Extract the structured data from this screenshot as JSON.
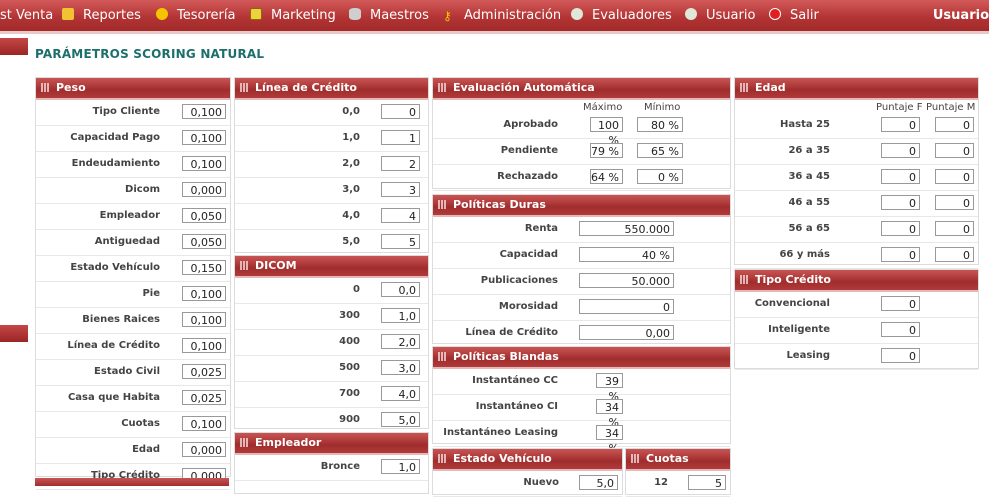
{
  "menu": {
    "items": [
      {
        "label": "st Venta",
        "icon": "none"
      },
      {
        "label": "Reportes",
        "icon": "report-icon"
      },
      {
        "label": "Tesorería",
        "icon": "coin-icon"
      },
      {
        "label": "Marketing",
        "icon": "monitor-icon"
      },
      {
        "label": "Maestros",
        "icon": "database-icon"
      },
      {
        "label": "Administración",
        "icon": "key-icon"
      },
      {
        "label": "Evaluadores",
        "icon": "gears-icon"
      },
      {
        "label": "Usuario",
        "icon": "gears-icon"
      },
      {
        "label": "Salir",
        "icon": "exit-icon"
      }
    ],
    "user_label": "Usuario"
  },
  "page": {
    "title": "PARÁMETROS SCORING NATURAL"
  },
  "colors": {
    "header_red": "#a02d2d",
    "title_teal": "#1d6f6b",
    "menu_red": "#b33434"
  },
  "panels": {
    "peso": {
      "title": "Peso",
      "rows": [
        {
          "label": "Tipo Cliente",
          "value": "0,100"
        },
        {
          "label": "Capacidad Pago",
          "value": "0,100"
        },
        {
          "label": "Endeudamiento",
          "value": "0,100"
        },
        {
          "label": "Dicom",
          "value": "0,000"
        },
        {
          "label": "Empleador",
          "value": "0,050"
        },
        {
          "label": "Antiguedad",
          "value": "0,050"
        },
        {
          "label": "Estado Vehículo",
          "value": "0,150"
        },
        {
          "label": "Pie",
          "value": "0,100"
        },
        {
          "label": "Bienes Raices",
          "value": "0,100"
        },
        {
          "label": "Línea de Crédito",
          "value": "0,100"
        },
        {
          "label": "Estado Civil",
          "value": "0,025"
        },
        {
          "label": "Casa que Habita",
          "value": "0,025"
        },
        {
          "label": "Cuotas",
          "value": "0,100"
        },
        {
          "label": "Edad",
          "value": "0,000"
        },
        {
          "label": "Tipo Crédito",
          "value": "0,000"
        }
      ]
    },
    "linea_credito": {
      "title": "Línea de Crédito",
      "rows": [
        {
          "label": "0,0",
          "value": "0"
        },
        {
          "label": "1,0",
          "value": "1"
        },
        {
          "label": "2,0",
          "value": "2"
        },
        {
          "label": "3,0",
          "value": "3"
        },
        {
          "label": "4,0",
          "value": "4"
        },
        {
          "label": "5,0",
          "value": "5"
        }
      ]
    },
    "dicom": {
      "title": "DICOM",
      "rows": [
        {
          "label": "0",
          "value": "0,0"
        },
        {
          "label": "300",
          "value": "1,0"
        },
        {
          "label": "400",
          "value": "2,0"
        },
        {
          "label": "500",
          "value": "3,0"
        },
        {
          "label": "700",
          "value": "4,0"
        },
        {
          "label": "900",
          "value": "5,0"
        }
      ]
    },
    "empleador": {
      "title": "Empleador",
      "rows": [
        {
          "label": "Bronce",
          "value": "1,0"
        }
      ]
    },
    "evaluacion": {
      "title": "Evaluación Automática",
      "col_max": "Máximo",
      "col_min": "Mínimo",
      "rows": [
        {
          "label": "Aprobado",
          "max": "100 %",
          "min": "80 %"
        },
        {
          "label": "Pendiente",
          "max": "79 %",
          "min": "65 %"
        },
        {
          "label": "Rechazado",
          "max": "64 %",
          "min": "0 %"
        }
      ]
    },
    "politicas_duras": {
      "title": "Políticas Duras",
      "rows": [
        {
          "label": "Renta",
          "value": "550.000"
        },
        {
          "label": "Capacidad",
          "value": "40 %"
        },
        {
          "label": "Publicaciones",
          "value": "50.000"
        },
        {
          "label": "Morosidad",
          "value": "0"
        },
        {
          "label": "Línea de Crédito",
          "value": "0,00"
        }
      ]
    },
    "politicas_blandas": {
      "title": "Políticas Blandas",
      "rows": [
        {
          "label": "Instantáneo CC",
          "value": "39 %"
        },
        {
          "label": "Instantáneo CI",
          "value": "34 %"
        },
        {
          "label": "Instantáneo Leasing",
          "value": "34 %"
        }
      ]
    },
    "estado_vehiculo": {
      "title": "Estado Vehículo",
      "rows": [
        {
          "label": "Nuevo",
          "value": "5,0"
        }
      ]
    },
    "cuotas": {
      "title": "Cuotas",
      "rows": [
        {
          "label": "12",
          "value": "5"
        }
      ]
    },
    "edad": {
      "title": "Edad",
      "col_f": "Puntaje F",
      "col_m": "Puntaje M",
      "rows": [
        {
          "label": "Hasta 25",
          "f": "0",
          "m": "0"
        },
        {
          "label": "26 a 35",
          "f": "0",
          "m": "0"
        },
        {
          "label": "36 a 45",
          "f": "0",
          "m": "0"
        },
        {
          "label": "46 a 55",
          "f": "0",
          "m": "0"
        },
        {
          "label": "56 a 65",
          "f": "0",
          "m": "0"
        },
        {
          "label": "66 y más",
          "f": "0",
          "m": "0"
        }
      ]
    },
    "tipo_credito": {
      "title": "Tipo Crédito",
      "rows": [
        {
          "label": "Convencional",
          "value": "0"
        },
        {
          "label": "Inteligente",
          "value": "0"
        },
        {
          "label": "Leasing",
          "value": "0"
        }
      ]
    }
  }
}
